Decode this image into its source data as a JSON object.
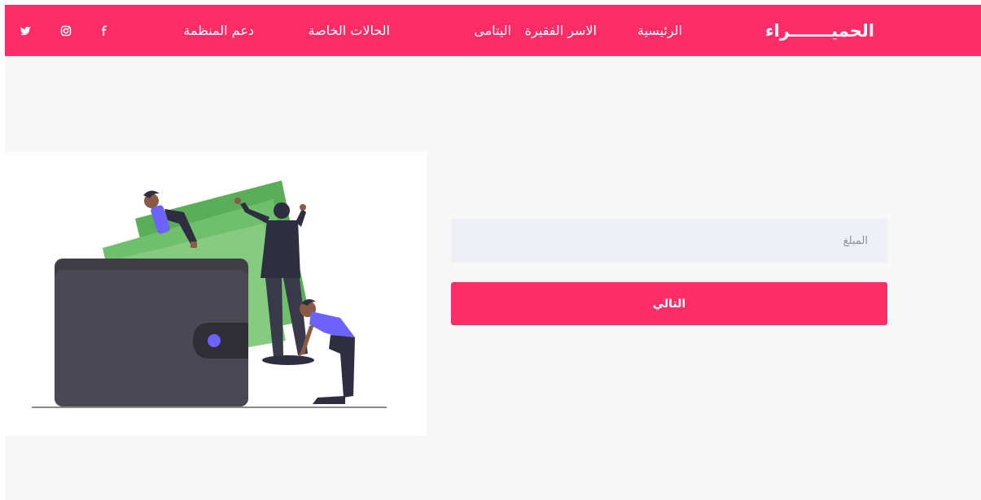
{
  "brand": {
    "name": "الحميـــــــراء"
  },
  "nav": {
    "items": [
      {
        "label": "الرئيسية"
      },
      {
        "label": "الاسر الفقيرة"
      },
      {
        "label": "اليتامى"
      },
      {
        "label": "الحالات الخاصة"
      },
      {
        "label": "دعم المنظمة"
      }
    ]
  },
  "social": [
    "facebook-icon",
    "instagram-icon",
    "twitter-icon"
  ],
  "form": {
    "amount_placeholder": "المبلغ",
    "amount_value": "",
    "next_label": "التالي"
  },
  "colors": {
    "accent": "#ff2d67",
    "page_background": "#f7f7f7",
    "input_background": "#eef0f6",
    "money_green": "#6fbf6b",
    "wallet": "#4a4853",
    "figure_shirt": "#6c63ff"
  }
}
